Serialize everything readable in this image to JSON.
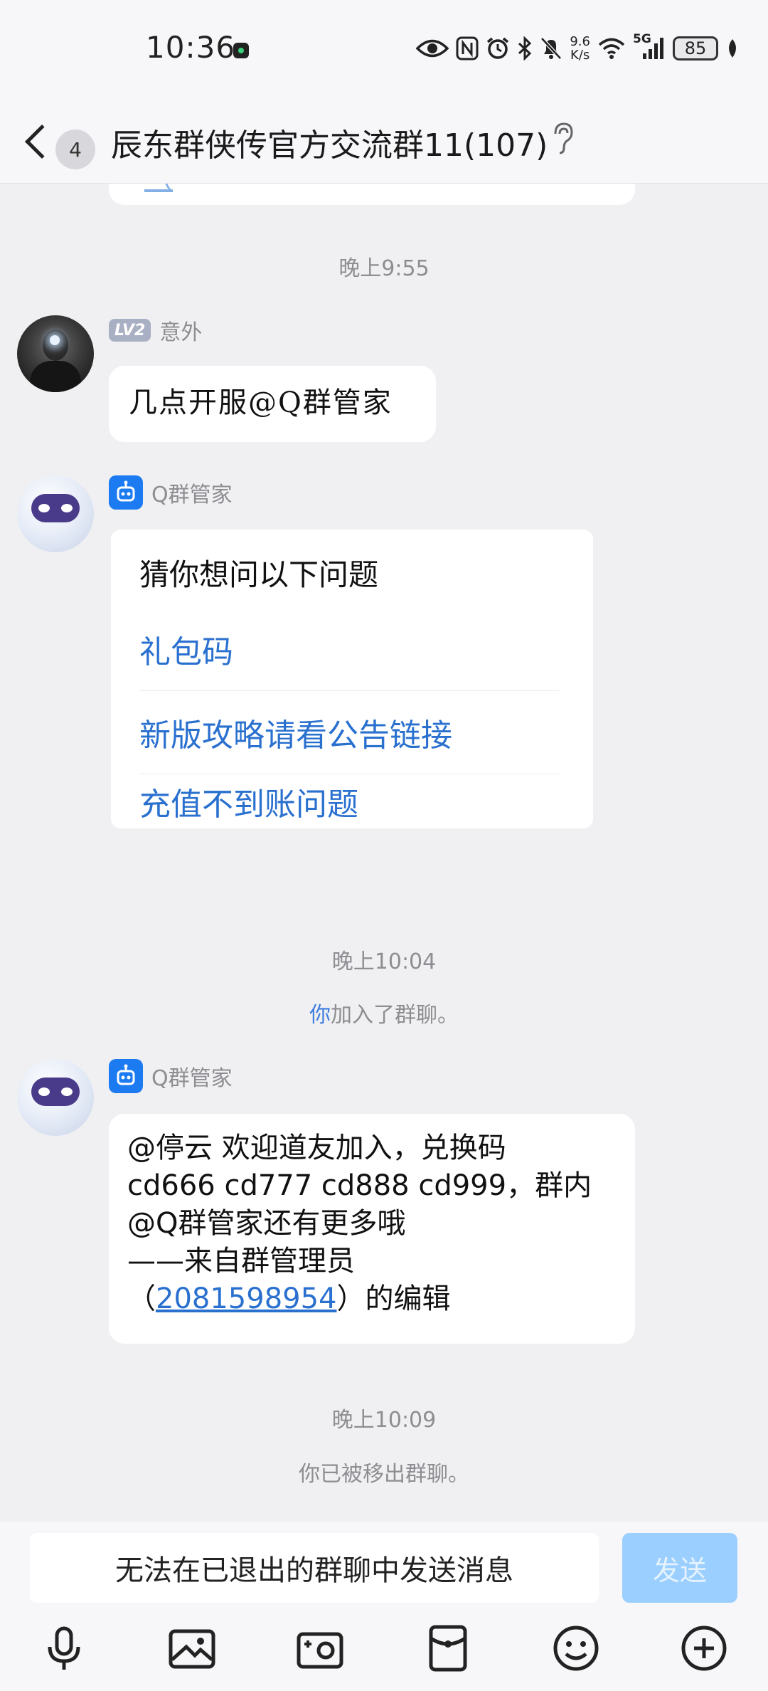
{
  "status_bar": {
    "time": "10:36",
    "net_speed_value": "9.6",
    "net_speed_unit": "K/s",
    "network": "5G",
    "battery": "85"
  },
  "header": {
    "unread_count": "4",
    "group_title": "辰东群侠传官方交流群11(107)"
  },
  "chat": {
    "time_1": "晚上9:55",
    "msg_1": {
      "sender_level": "LV2",
      "sender_name": "意外",
      "text": "几点开服@Q群管家"
    },
    "msg_2": {
      "sender_name": "Q群管家",
      "card_title": "猜你想问以下问题",
      "items": [
        "礼包码",
        "新版攻略请看公告链接",
        "充值不到账问题"
      ]
    },
    "time_2": "晚上10:04",
    "join_notice_you": "你",
    "join_notice_rest": "加入了群聊。",
    "msg_3": {
      "sender_name": "Q群管家",
      "line_1": "@停云 欢迎道友加入，兑换码",
      "line_2": "cd666 cd777 cd888 cd999，群内",
      "line_3": "@Q群管家还有更多哦",
      "line_4": "——来自群管理员",
      "line_5_open": "（",
      "line_5_link": "2081598954",
      "line_5_close": "）的编辑"
    },
    "time_3": "晚上10:09",
    "removed_notice": "你已被移出群聊。"
  },
  "input": {
    "placeholder": "无法在已退出的群聊中发送消息",
    "send_label": "发送"
  },
  "colors": {
    "accent": "#2a70cf",
    "send_disabled": "#9acfff",
    "bot_badge": "#1d7bf2"
  },
  "toolbar_icons": [
    "microphone-icon",
    "image-icon",
    "camera-icon",
    "red-packet-icon",
    "emoji-icon",
    "plus-icon"
  ]
}
